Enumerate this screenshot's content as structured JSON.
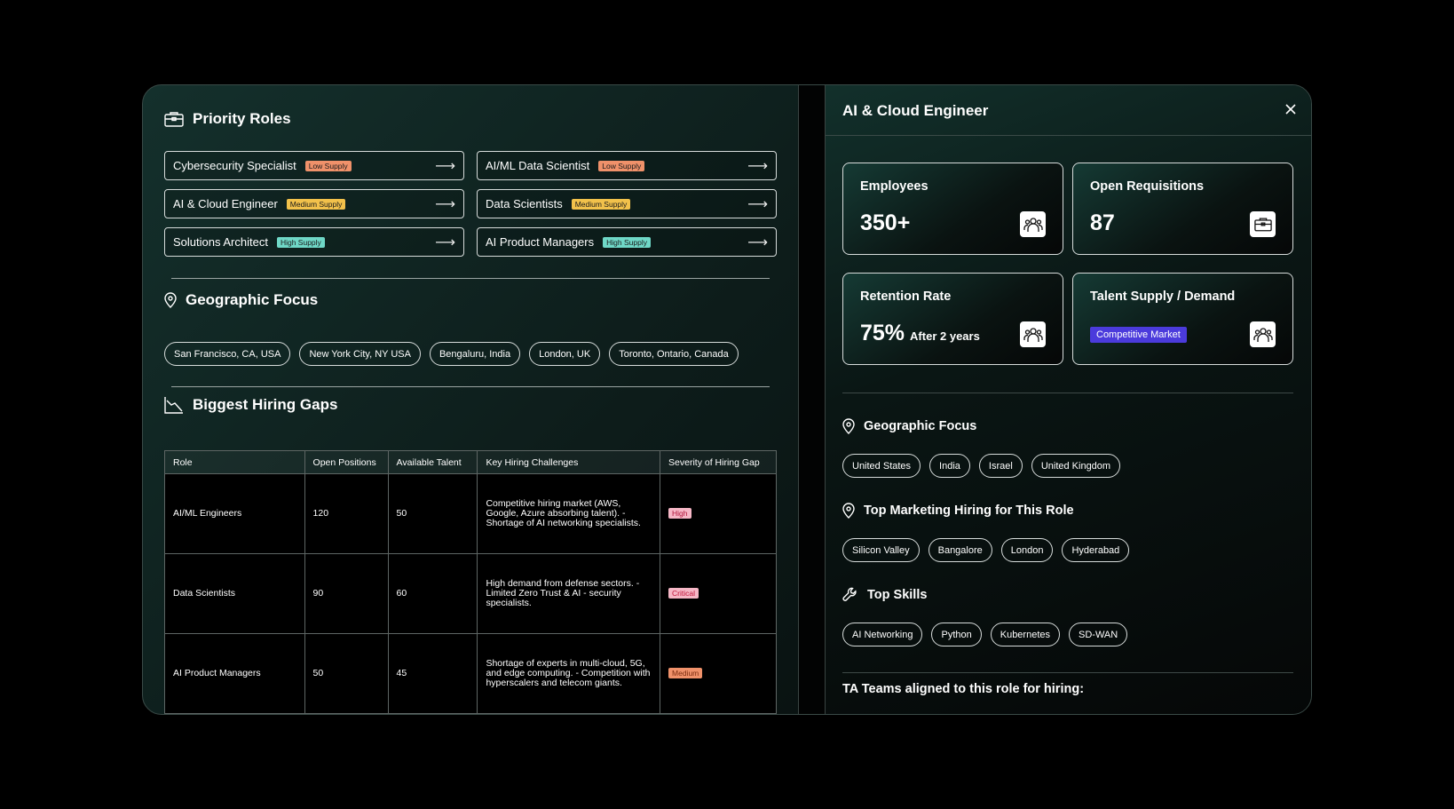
{
  "left": {
    "priority_roles": {
      "title": "Priority Roles",
      "roles": [
        {
          "label": "Cybersecurity Specialist",
          "supply": "Low Supply",
          "level": "low"
        },
        {
          "label": "AI/ML Data Scientist",
          "supply": "Low Supply",
          "level": "low"
        },
        {
          "label": "AI & Cloud Engineer",
          "supply": "Medium Supply",
          "level": "medium"
        },
        {
          "label": "Data Scientists",
          "supply": "Medium Supply",
          "level": "medium"
        },
        {
          "label": "Solutions Architect",
          "supply": "High Supply",
          "level": "high"
        },
        {
          "label": "AI Product Managers",
          "supply": "High Supply",
          "level": "high"
        }
      ]
    },
    "geographic_focus": {
      "title": "Geographic Focus",
      "locations": [
        "San Francisco, CA, USA",
        "New York City, NY USA",
        "Bengaluru, India",
        "London, UK",
        "Toronto, Ontario, Canada"
      ]
    },
    "hiring_gaps": {
      "title": "Biggest Hiring Gaps",
      "columns": [
        "Role",
        "Open Positions",
        "Available Talent",
        "Key Hiring Challenges",
        "Severity of Hiring Gap"
      ],
      "rows": [
        {
          "role": "AI/ML Engineers",
          "open": "120",
          "available": "50",
          "challenges": "Competitive hiring market (AWS, Google, Azure absorbing talent). - Shortage of AI networking specialists.",
          "severity": "High",
          "sev_level": "high"
        },
        {
          "role": "Data Scientists",
          "open": "90",
          "available": "60",
          "challenges": "High demand from defense sectors. - Limited Zero Trust & AI - security specialists.",
          "severity": "Critical",
          "sev_level": "critical"
        },
        {
          "role": "AI Product Managers",
          "open": "50",
          "available": "45",
          "challenges": "Shortage of experts in multi-cloud, 5G, and edge computing. - Competition with hyperscalers and telecom giants.",
          "severity": "Medium",
          "sev_level": "medium"
        }
      ]
    }
  },
  "right": {
    "title": "AI & Cloud Engineer",
    "stats": {
      "employees": {
        "label": "Employees",
        "value": "350+"
      },
      "open_requisitions": {
        "label": "Open Requisitions",
        "value": "87"
      },
      "retention_rate": {
        "label": "Retention Rate",
        "value": "75%",
        "sub": "After 2 years"
      },
      "talent_supply": {
        "label": "Talent Supply / Demand",
        "badge": "Competitive Market",
        "badge_color": "#4b3bdc"
      }
    },
    "geographic_focus": {
      "title": "Geographic Focus",
      "items": [
        "United States",
        "India",
        "Israel",
        "United Kingdom"
      ]
    },
    "top_marketing": {
      "title": "Top Marketing Hiring for This Role",
      "items": [
        "Silicon Valley",
        "Bangalore",
        "London",
        "Hyderabad"
      ]
    },
    "top_skills": {
      "title": "Top Skills",
      "items": [
        "AI Networking",
        "Python",
        "Kubernetes",
        "SD-WAN"
      ]
    },
    "ta_teams": {
      "title": "TA Teams aligned to this role for hiring:"
    }
  },
  "colors": {
    "low_supply": "#f0916a",
    "medium_supply": "#f2c14b",
    "high_supply": "#6fd8c7",
    "accent": "#4b3bdc"
  }
}
